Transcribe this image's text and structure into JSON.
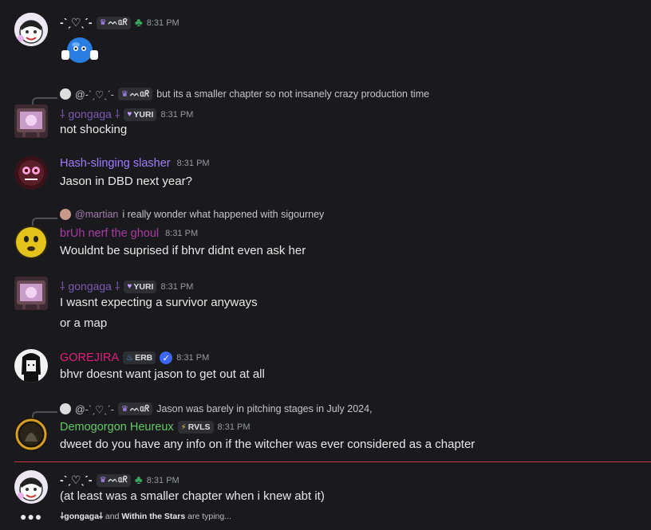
{
  "colors": {
    "background": "#1a1a1e",
    "gongaga": "#7b5cb0",
    "hash": "#a37bff",
    "bruh": "#a83ba0",
    "gorejira": "#e21e7c",
    "demogorgon": "#63c964",
    "divider": "#c9323b"
  },
  "messages": [
    {
      "author": "-ˋˏ♡ˎˊ-",
      "badge_text": "ᨓᥲᖇ",
      "time": "8:31 PM",
      "content": ""
    },
    {
      "reply_author": "@-ˋˏ♡ˎˊ-",
      "reply_badge": "ᨓᥲᖇ",
      "reply_text": "but its a smaller chapter so not insanely crazy production time",
      "author": "⸸ gongaga ⸸",
      "badge_text": "YURI",
      "time": "8:31 PM",
      "content": "not shocking"
    },
    {
      "author": "Hash-slinging slasher",
      "time": "8:31 PM",
      "content": "Jason in DBD next year?"
    },
    {
      "reply_author": "@martian",
      "reply_text": "i really wonder what happened with sigourney",
      "author": "brUh nerf the ghoul",
      "time": "8:31 PM",
      "content": "Wouldnt be suprised if bhvr didnt even ask her"
    },
    {
      "author": "⸸ gongaga ⸸",
      "badge_text": "YURI",
      "time": "8:31 PM",
      "content": "I wasnt expecting a survivor anyways",
      "content2": "or a map"
    },
    {
      "author": "GOREJIRA",
      "badge_text": "ERB",
      "time": "8:31 PM",
      "content": "bhvr doesnt want jason to get out  at all"
    },
    {
      "reply_author": "@-ˋˏ♡ˎˊ-",
      "reply_badge": "ᨓᥲᖇ",
      "reply_text": "Jason was barely in pitching stages in July 2024,",
      "author": "Demogorgon Heureux",
      "badge_text": "RVLS",
      "time": "8:31 PM",
      "content": "dweet do you have any info on if the witcher was ever considered as a chapter"
    },
    {
      "author": "-ˋˏ♡ˎˊ-",
      "badge_text": "ᨓᥲᖇ",
      "time": "8:31 PM",
      "content": "(at least was a smaller chapter when i knew abt it)"
    }
  ],
  "typing": {
    "dots": "●●●",
    "user1": "⸸gongaga⸸",
    "and": "and",
    "user2": "Within the Stars",
    "suffix": "are typing..."
  }
}
